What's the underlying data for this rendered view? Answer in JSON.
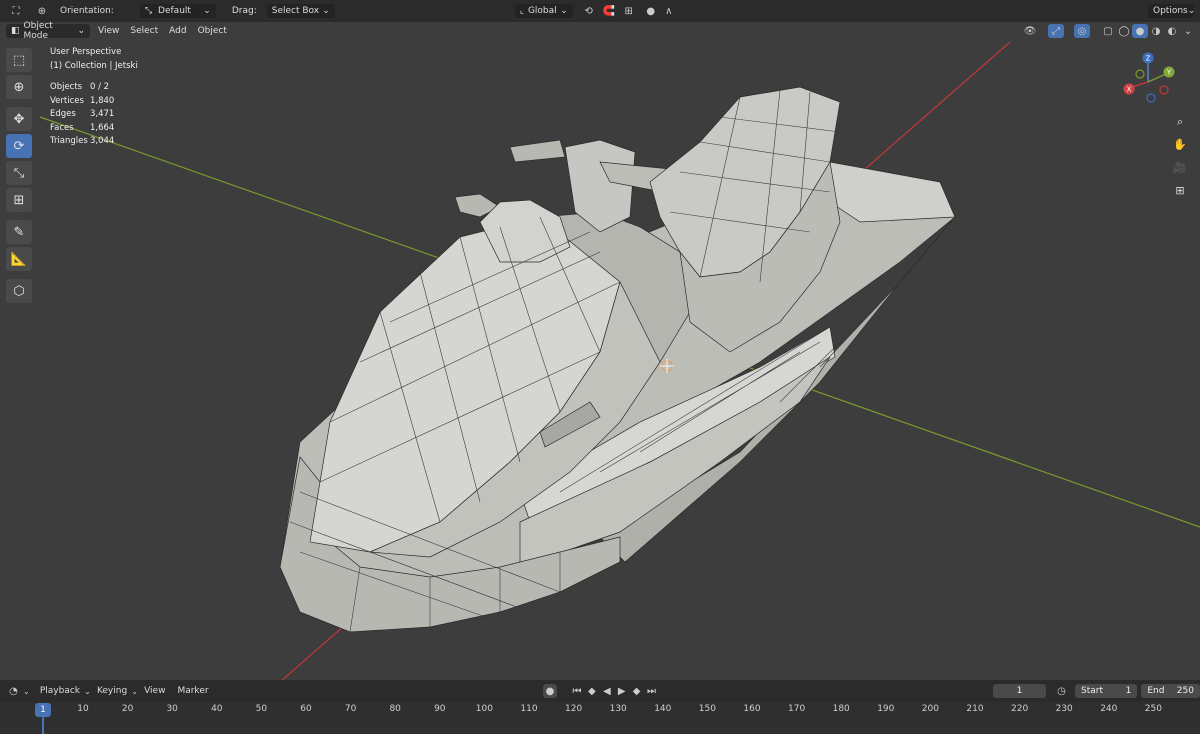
{
  "topbar": {
    "orientation_label": "Orientation:",
    "orientation_value": "Default",
    "drag_label": "Drag:",
    "drag_value": "Select Box",
    "transform_orientation": "Global",
    "options_label": "Options"
  },
  "viewport_header": {
    "mode": "Object Mode",
    "menus": [
      "View",
      "Select",
      "Add",
      "Object"
    ]
  },
  "overlay": {
    "perspective": "User Perspective",
    "collection": "(1) Collection | Jetski",
    "stats": [
      {
        "label": "Objects",
        "value": "0 / 2"
      },
      {
        "label": "Vertices",
        "value": "1,840"
      },
      {
        "label": "Edges",
        "value": "3,471"
      },
      {
        "label": "Faces",
        "value": "1,664"
      },
      {
        "label": "Triangles",
        "value": "3,044"
      }
    ]
  },
  "gizmo": {
    "z": "Z",
    "x": "X",
    "y": "Y"
  },
  "timeline": {
    "menus": [
      "Playback",
      "Keying",
      "View",
      "Marker"
    ],
    "current_frame": "1",
    "start_label": "Start",
    "start_value": "1",
    "end_label": "End",
    "end_value": "250",
    "ticks": [
      "10",
      "20",
      "30",
      "40",
      "50",
      "60",
      "70",
      "80",
      "90",
      "100",
      "110",
      "120",
      "130",
      "140",
      "150",
      "160",
      "170",
      "180",
      "190",
      "200",
      "210",
      "220",
      "230",
      "240",
      "250"
    ]
  },
  "colors": {
    "accent": "#4772b3",
    "x_axis": "#c0393b",
    "y_axis": "#7a9a2e",
    "background": "#3d3d3d"
  }
}
